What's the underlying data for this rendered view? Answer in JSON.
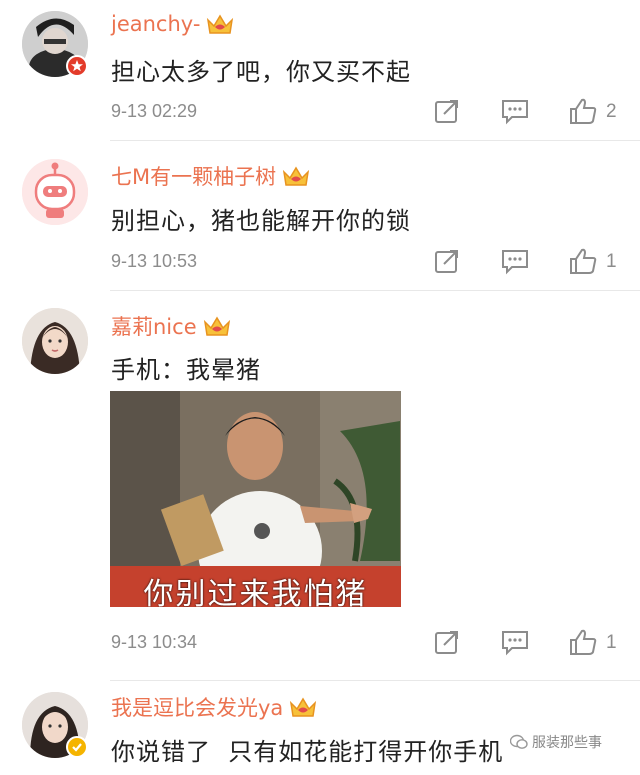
{
  "comments": [
    {
      "username": "jeanchy-",
      "text": "担心太多了吧，你又买不起",
      "timestamp": "9-13 02:29",
      "likes": "2"
    },
    {
      "username": "七M有一颗柚子树",
      "text": "别担心，猪也能解开你的锁",
      "timestamp": "9-13 10:53",
      "likes": "1"
    },
    {
      "username": "嘉莉nice",
      "text": "手机：我晕猪",
      "timestamp": "9-13 10:34",
      "likes": "1",
      "image_caption": "你别过来我怕猪"
    },
    {
      "username": "我是逗比会发光ya",
      "text": "你说错了  只有如花能打得开你手机"
    }
  ],
  "watermark": "服装那些事",
  "colors": {
    "username": "#eb7350",
    "text": "#222222",
    "meta": "#8c8c8c",
    "divider": "#e8e8e8"
  },
  "icons": [
    "crown-icon",
    "repost-icon",
    "comment-icon",
    "like-icon",
    "verified-badge-icon"
  ]
}
